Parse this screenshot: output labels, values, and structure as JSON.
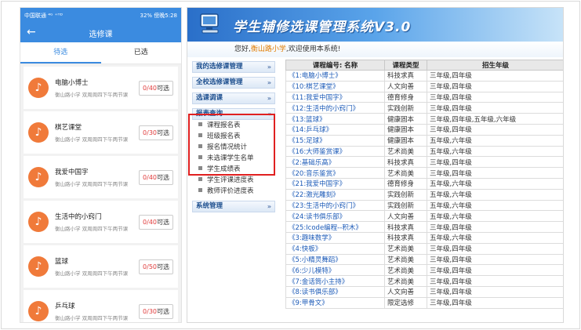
{
  "phone": {
    "status_left": "中国联通 ⁴ᴳ ⁺ᴴᴰ",
    "status_right": "32%  傍晚5:28",
    "title": "选修课",
    "tab_pending": "待选",
    "tab_selected": "已选",
    "courses": [
      {
        "name": "电脑小博士",
        "desc": "衡山路小学   双周周四下午两节课",
        "quota": "0/40",
        "action": "可选"
      },
      {
        "name": "棋艺课堂",
        "desc": "衡山路小学   双周周四下午两节课",
        "quota": "0/30",
        "action": "可选"
      },
      {
        "name": "我爱中国字",
        "desc": "衡山路小学   双周周四下午两节课",
        "quota": "0/40",
        "action": "可选"
      },
      {
        "name": "生活中的小窍门",
        "desc": "衡山路小学   双周周四下午两节课",
        "quota": "0/40",
        "action": "可选"
      },
      {
        "name": "篮球",
        "desc": "衡山路小学   双周周四下午两节课",
        "quota": "0/50",
        "action": "可选"
      },
      {
        "name": "乒乓球",
        "desc": "衡山路小学   双周周四下午两节课",
        "quota": "0/30",
        "action": "可选"
      }
    ]
  },
  "web": {
    "title": "学生辅修选课管理系统V3.0",
    "greet_pre": "您好,",
    "school": "衡山路小学",
    "greet_post": ",欢迎使用本系统!",
    "menus": {
      "m1": "我的选修课管理",
      "m2": "全校选修课管理",
      "m3": "选课调课",
      "m4": "报表查询",
      "s1": "课程报名表",
      "s2": "班级报名表",
      "s3": "报名情况统计",
      "s4": "未选课学生名单",
      "s5": "学生成绩表",
      "s6": "学生评课进度表",
      "s7": "教师评价进度表",
      "m5": "系统管理"
    },
    "table": {
      "headers": [
        "课程编号: 名称",
        "课程类型",
        "招生年级"
      ],
      "rows": [
        [
          "《1:电脑小博士》",
          "科技求真",
          "三年级,四年级"
        ],
        [
          "《10:棋艺课堂》",
          "人文向善",
          "三年级,四年级"
        ],
        [
          "《11:我爱中国字》",
          "德育修身",
          "三年级,四年级"
        ],
        [
          "《12:生活中的小窍门》",
          "实践创新",
          "三年级,四年级"
        ],
        [
          "《13:篮球》",
          "健康固本",
          "三年级,四年级,五年级,六年级"
        ],
        [
          "《14:乒乓球》",
          "健康固本",
          "三年级,四年级"
        ],
        [
          "《15:足球》",
          "健康固本",
          "五年级,六年级"
        ],
        [
          "《16:大师鉴赏课》",
          "艺术尚美",
          "五年级,六年级"
        ],
        [
          "《2:基础乐高》",
          "科技求真",
          "三年级,四年级"
        ],
        [
          "《20:音乐鉴赏》",
          "艺术尚美",
          "三年级,四年级"
        ],
        [
          "《21:我爱中国字》",
          "德育修身",
          "五年级,六年级"
        ],
        [
          "《22:激光雕刻》",
          "实践创新",
          "五年级,六年级"
        ],
        [
          "《23:生活中的小窍门》",
          "实践创新",
          "五年级,六年级"
        ],
        [
          "《24:读书俱乐部》",
          "人文向善",
          "五年级,六年级"
        ],
        [
          "《25:Icode编程--积木》",
          "科技求真",
          "三年级,四年级"
        ],
        [
          "《3:趣味数学》",
          "科技求真",
          "五年级,六年级"
        ],
        [
          "《4:快板》",
          "艺术尚美",
          "三年级,四年级"
        ],
        [
          "《5:小精灵舞蹈》",
          "艺术尚美",
          "三年级,四年级"
        ],
        [
          "《6:少儿模特》",
          "艺术尚美",
          "三年级,四年级"
        ],
        [
          "《7:金话筒小主持》",
          "艺术尚美",
          "三年级,四年级"
        ],
        [
          "《8:读书俱乐部》",
          "人文向善",
          "三年级,四年级"
        ],
        [
          "《9:甲骨文》",
          "限定选修",
          "三年级,四年级"
        ]
      ]
    }
  }
}
